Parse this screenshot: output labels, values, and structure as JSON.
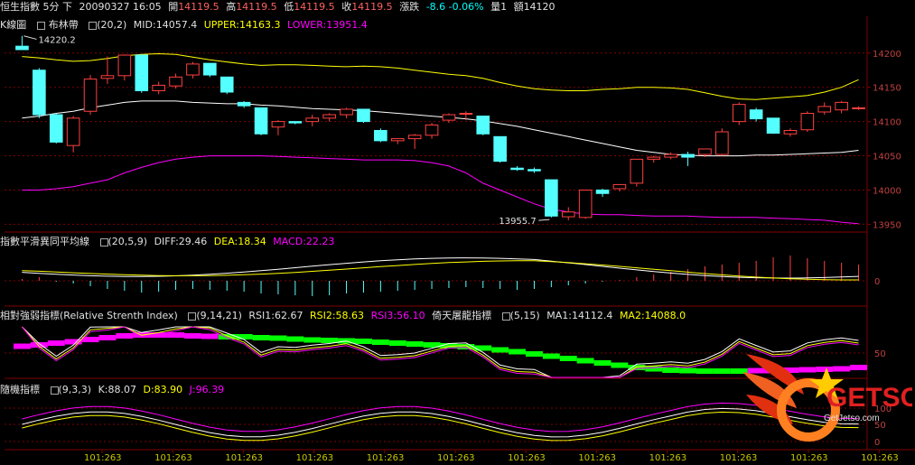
{
  "header": {
    "title": "恒生指數 5分 下",
    "datetime": "20090327 16:05",
    "open_label": "開",
    "open": "14119.5",
    "high_label": "高",
    "high": "14119.5",
    "low_label": "低",
    "low": "14119.5",
    "close_label": "收",
    "close": "14119.5",
    "change_label": "漲跌",
    "change": "-8.6 -0.06%",
    "volume_label": "量",
    "volume": "1",
    "amount_label": "額",
    "amount": "14120"
  },
  "panels": {
    "kline": {
      "title": "K線圖",
      "indicator": "布林帶",
      "params": "(20,2)",
      "mid": "MID:14057.4",
      "upper": "UPPER:14163.3",
      "lower": "LOWER:13951.4",
      "high_marker": "14220.2",
      "low_marker": "13955.7"
    },
    "macd": {
      "title": "指數平滑異同平均線",
      "params": "(20,5,9)",
      "diff": "DIFF:29.46",
      "dea": "DEA:18.34",
      "macd": "MACD:22.23"
    },
    "rsi": {
      "title": "相對強弱指標(Relative Strenth Index)",
      "params": "(9,14,21)",
      "rsi1": "RSI1:62.67",
      "rsi2": "RSI2:58.63",
      "rsi3": "RSI3:56.10",
      "title2": "倚天屠龍指標",
      "params2": "(5,15)",
      "ma1": "MA1:14112.4",
      "ma2": "MA2:14088.0"
    },
    "kdj": {
      "title": "隨機指標",
      "params": "(9,3,3)",
      "k": "K:88.07",
      "d": "D:83.90",
      "j": "J:96.39"
    }
  },
  "axis": {
    "price_ticks": [
      "14200",
      "14150",
      "14100",
      "14050",
      "14000",
      "13950"
    ],
    "macd_ticks": [
      "0"
    ],
    "rsi_ticks": [
      "50"
    ],
    "kdj_ticks": [
      "100",
      "50",
      "0"
    ],
    "time_labels": [
      "101:263",
      "101:263",
      "101:263",
      "101:263",
      "101:263",
      "101:263",
      "101:263",
      "101:263",
      "101:263",
      "101:263",
      "101:263",
      "101:263"
    ]
  },
  "watermark": {
    "text": "GETSO",
    "subtext": "GetJetso.com"
  },
  "colors": {
    "up": "#ff4040",
    "down": "#54ffff",
    "mid": "#ffffff",
    "upper": "#ffff00",
    "lower": "#ff00ff",
    "grid": "#800000"
  },
  "chart_data": {
    "type": "candlestick",
    "ylim": [
      13940,
      14230
    ],
    "candles": [
      {
        "o": 14210,
        "h": 14225,
        "l": 14205,
        "c": 14205
      },
      {
        "o": 14175,
        "h": 14178,
        "l": 14105,
        "c": 14110
      },
      {
        "o": 14110,
        "h": 14112,
        "l": 14068,
        "c": 14070
      },
      {
        "o": 14065,
        "h": 14108,
        "l": 14055,
        "c": 14105
      },
      {
        "o": 14115,
        "h": 14168,
        "l": 14110,
        "c": 14162
      },
      {
        "o": 14163,
        "h": 14195,
        "l": 14155,
        "c": 14167
      },
      {
        "o": 14167,
        "h": 14198,
        "l": 14160,
        "c": 14197
      },
      {
        "o": 14197,
        "h": 14198,
        "l": 14142,
        "c": 14145
      },
      {
        "o": 14145,
        "h": 14158,
        "l": 14140,
        "c": 14153
      },
      {
        "o": 14152,
        "h": 14170,
        "l": 14148,
        "c": 14165
      },
      {
        "o": 14168,
        "h": 14187,
        "l": 14163,
        "c": 14184
      },
      {
        "o": 14185,
        "h": 14185,
        "l": 14165,
        "c": 14168
      },
      {
        "o": 14165,
        "h": 14165,
        "l": 14140,
        "c": 14143
      },
      {
        "o": 14128,
        "h": 14130,
        "l": 14120,
        "c": 14123
      },
      {
        "o": 14120,
        "h": 14120,
        "l": 14080,
        "c": 14082
      },
      {
        "o": 14092,
        "h": 14102,
        "l": 14080,
        "c": 14100
      },
      {
        "o": 14100,
        "h": 14100,
        "l": 14096,
        "c": 14098
      },
      {
        "o": 14100,
        "h": 14110,
        "l": 14093,
        "c": 14105
      },
      {
        "o": 14105,
        "h": 14112,
        "l": 14100,
        "c": 14110
      },
      {
        "o": 14110,
        "h": 14120,
        "l": 14105,
        "c": 14118
      },
      {
        "o": 14118,
        "h": 14118,
        "l": 14098,
        "c": 14100
      },
      {
        "o": 14087,
        "h": 14090,
        "l": 14070,
        "c": 14072
      },
      {
        "o": 14072,
        "h": 14075,
        "l": 14067,
        "c": 14075
      },
      {
        "o": 14075,
        "h": 14082,
        "l": 14060,
        "c": 14080
      },
      {
        "o": 14080,
        "h": 14098,
        "l": 14075,
        "c": 14095
      },
      {
        "o": 14102,
        "h": 14112,
        "l": 14098,
        "c": 14110
      },
      {
        "o": 14112,
        "h": 14115,
        "l": 14102,
        "c": 14112
      },
      {
        "o": 14108,
        "h": 14108,
        "l": 14080,
        "c": 14082
      },
      {
        "o": 14078,
        "h": 14078,
        "l": 14040,
        "c": 14042
      },
      {
        "o": 14032,
        "h": 14035,
        "l": 14028,
        "c": 14030
      },
      {
        "o": 14030,
        "h": 14033,
        "l": 14025,
        "c": 14028
      },
      {
        "o": 14015,
        "h": 14015,
        "l": 13960,
        "c": 13962
      },
      {
        "o": 13961,
        "h": 13975,
        "l": 13956,
        "c": 13968
      },
      {
        "o": 13960,
        "h": 14000,
        "l": 13958,
        "c": 14000
      },
      {
        "o": 14000,
        "h": 14002,
        "l": 13990,
        "c": 13995
      },
      {
        "o": 14002,
        "h": 14008,
        "l": 13998,
        "c": 14008
      },
      {
        "o": 14010,
        "h": 14045,
        "l": 14005,
        "c": 14045
      },
      {
        "o": 14045,
        "h": 14050,
        "l": 14040,
        "c": 14048
      },
      {
        "o": 14048,
        "h": 14055,
        "l": 14045,
        "c": 14052
      },
      {
        "o": 14052,
        "h": 14056,
        "l": 14035,
        "c": 14048
      },
      {
        "o": 14052,
        "h": 14060,
        "l": 14048,
        "c": 14060
      },
      {
        "o": 14052,
        "h": 14090,
        "l": 14050,
        "c": 14085
      },
      {
        "o": 14100,
        "h": 14128,
        "l": 14095,
        "c": 14125
      },
      {
        "o": 14117,
        "h": 14120,
        "l": 14100,
        "c": 14104
      },
      {
        "o": 14105,
        "h": 14105,
        "l": 14082,
        "c": 14083
      },
      {
        "o": 14082,
        "h": 14090,
        "l": 14078,
        "c": 14087
      },
      {
        "o": 14088,
        "h": 14115,
        "l": 14085,
        "c": 14112
      },
      {
        "o": 14114,
        "h": 14128,
        "l": 14110,
        "c": 14122
      },
      {
        "o": 14117,
        "h": 14130,
        "l": 14112,
        "c": 14128
      },
      {
        "o": 14120,
        "h": 14122,
        "l": 14117,
        "c": 14120
      }
    ],
    "upper": [
      14195,
      14193,
      14190,
      14188,
      14189,
      14192,
      14196,
      14198,
      14199,
      14198,
      14194,
      14190,
      14187,
      14184,
      14182,
      14183,
      14183,
      14182,
      14181,
      14180,
      14181,
      14180,
      14178,
      14175,
      14172,
      14169,
      14167,
      14163,
      14157,
      14152,
      14148,
      14146,
      14145,
      14145,
      14147,
      14148,
      14150,
      14150,
      14149,
      14147,
      14142,
      14137,
      14133,
      14132,
      14134,
      14136,
      14138,
      14143,
      14150,
      14161
    ],
    "mid": [
      14105,
      14108,
      14112,
      14115,
      14120,
      14124,
      14128,
      14130,
      14130,
      14130,
      14128,
      14127,
      14126,
      14126,
      14124,
      14123,
      14121,
      14119,
      14118,
      14117,
      14116,
      14114,
      14112,
      14110,
      14108,
      14106,
      14104,
      14101,
      14097,
      14093,
      14088,
      14083,
      14078,
      14073,
      14068,
      14063,
      14058,
      14055,
      14052,
      14051,
      14050,
      14050,
      14050,
      14051,
      14051,
      14052,
      14053,
      14054,
      14055,
      14058
    ],
    "lower": [
      14000,
      14000,
      14002,
      14005,
      14010,
      14015,
      14025,
      14033,
      14040,
      14045,
      14048,
      14050,
      14050,
      14050,
      14050,
      14049,
      14048,
      14047,
      14046,
      14045,
      14044,
      14044,
      14044,
      14043,
      14040,
      14035,
      14025,
      14010,
      14000,
      13990,
      13980,
      13972,
      13968,
      13965,
      13964,
      13964,
      13963,
      13962,
      13962,
      13962,
      13961,
      13960,
      13960,
      13960,
      13959,
      13958,
      13957,
      13956,
      13953,
      13951
    ]
  }
}
